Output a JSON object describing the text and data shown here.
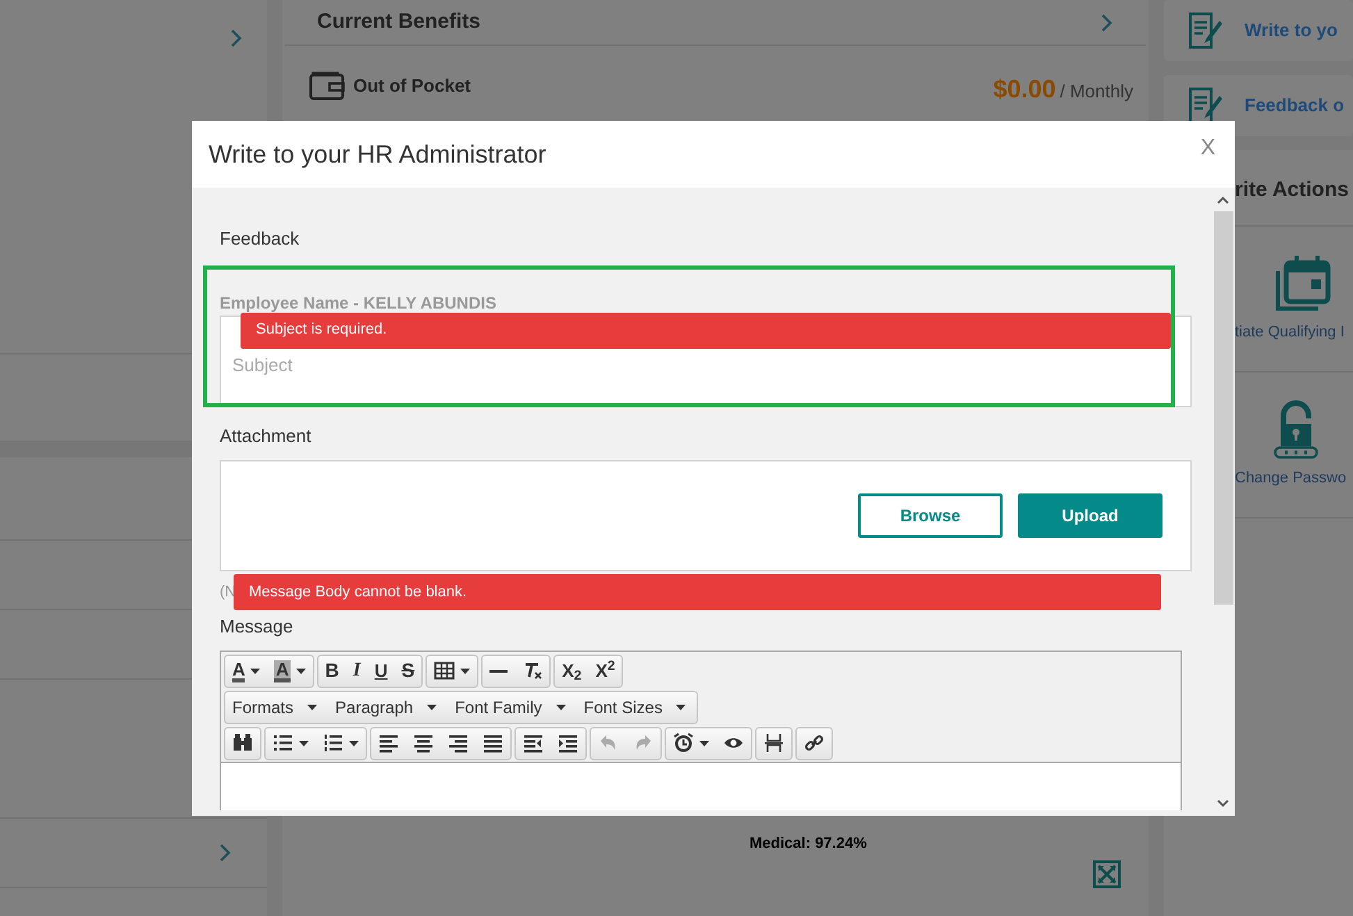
{
  "background": {
    "benefits": {
      "title": "Current Benefits",
      "out_of_pocket": {
        "label": "Out of Pocket",
        "amount": "$0.00",
        "period": "/ Monthly"
      },
      "chart_label": "Medical: 97.24%"
    },
    "side_cards": [
      {
        "label": "Write to yo"
      },
      {
        "label": "Feedback o"
      }
    ],
    "actions": {
      "title": "rite Actions",
      "items": [
        {
          "kind": "calendar",
          "label": "tiate Qualifying I"
        },
        {
          "kind": "lock",
          "label": "Change Passwo"
        }
      ]
    }
  },
  "modal": {
    "title": "Write to your HR Administrator",
    "close": "X",
    "feedback_label": "Feedback",
    "employee_name": "Employee Name - KELLY ABUNDIS",
    "subject": {
      "placeholder": "Subject",
      "error": "Subject is required."
    },
    "attachment": {
      "label": "Attachment",
      "buttons": [
        {
          "kind": "outline",
          "label": "Browse"
        },
        {
          "kind": "solid",
          "label": "Upload"
        }
      ],
      "hint_fragment": "(N",
      "error": "Message Body cannot be blank."
    },
    "message": {
      "label": "Message",
      "toolbar_rows": [
        [
          [
            {
              "kind": "forecolor",
              "label": "A"
            },
            {
              "kind": "backcolor",
              "label": "A"
            }
          ],
          [
            {
              "kind": "bold",
              "label": "B"
            },
            {
              "kind": "italic",
              "label": "I"
            },
            {
              "kind": "underline",
              "label": "U"
            },
            {
              "kind": "strike",
              "label": "S"
            }
          ],
          [
            {
              "kind": "table"
            }
          ],
          [
            {
              "kind": "hr"
            },
            {
              "kind": "clear"
            }
          ],
          [
            {
              "kind": "script",
              "label": "X$_{2}$"
            },
            {
              "kind": "script",
              "label": "X$^{2}$"
            }
          ]
        ],
        [
          [
            {
              "kind": "select",
              "label": "Formats"
            },
            {
              "kind": "select",
              "label": "Paragraph"
            },
            {
              "kind": "select",
              "label": "Font Family"
            },
            {
              "kind": "select",
              "label": "Font Sizes"
            }
          ]
        ],
        [
          [
            {
              "kind": "binoculars",
              "disabled": false
            }
          ],
          [
            {
              "kind": "bullets",
              "disabled": false
            },
            {
              "kind": "numbers",
              "disabled": false
            }
          ],
          [
            {
              "kind": "align-left",
              "disabled": false
            },
            {
              "kind": "align-center",
              "disabled": false
            },
            {
              "kind": "align-right",
              "disabled": false
            },
            {
              "kind": "justify",
              "disabled": false
            }
          ],
          [
            {
              "kind": "outdent",
              "disabled": false
            },
            {
              "kind": "indent",
              "disabled": false
            }
          ],
          [
            {
              "kind": "undo",
              "disabled": true
            },
            {
              "kind": "redo",
              "disabled": true
            }
          ],
          [
            {
              "kind": "clock",
              "disabled": false
            },
            {
              "kind": "eye",
              "disabled": false
            }
          ],
          [
            {
              "kind": "pagebreak",
              "disabled": false
            }
          ],
          [
            {
              "kind": "link",
              "disabled": false
            }
          ]
        ]
      ]
    }
  }
}
